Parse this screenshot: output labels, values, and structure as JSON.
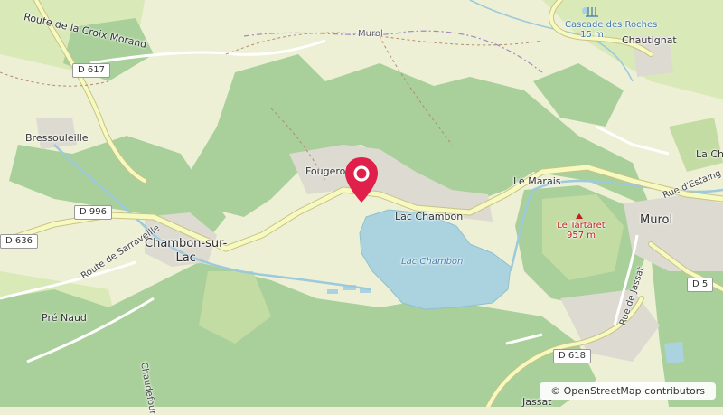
{
  "map": {
    "places": {
      "route_croix_morand": "Route de la Croix Morand",
      "murol_top": "Murol",
      "cascade": "Cascade des Roches",
      "cascade_height": "15 m",
      "chautignat": "Chautignat",
      "bressouleille": "Bressouleille",
      "fougerol": "Fougerol",
      "le_marais": "Le Marais",
      "la_cha": "La Cha",
      "lac_chambon_village": "Lac Chambon",
      "lac_chambon_water": "Lac Chambon",
      "chambon_line1": "Chambon-sur-",
      "chambon_line2": "Lac",
      "route_sarraveille": "Route de Sarraveille",
      "pre_naud": "Pré Naud",
      "chaudefour": "Chaudefour",
      "murol_town": "Murol",
      "rue_estaing": "Rue d'Estaing",
      "rue_jassat": "Rue de Jassat",
      "jassat": "Jassat",
      "tartaret_name": "Le Tartaret",
      "tartaret_elev": "957 m"
    },
    "roads": {
      "d617": "D 617",
      "d996": "D 996",
      "d636": "D 636",
      "d618": "D 618",
      "d5": "D 5"
    },
    "attribution": "© OpenStreetMap contributors",
    "colors": {
      "forest": "#a9d09a",
      "grass": "#cdebb0",
      "land": "#eef0d5",
      "water": "#aad3df",
      "road": "#f7fabf",
      "marker": "#e0204a"
    }
  }
}
